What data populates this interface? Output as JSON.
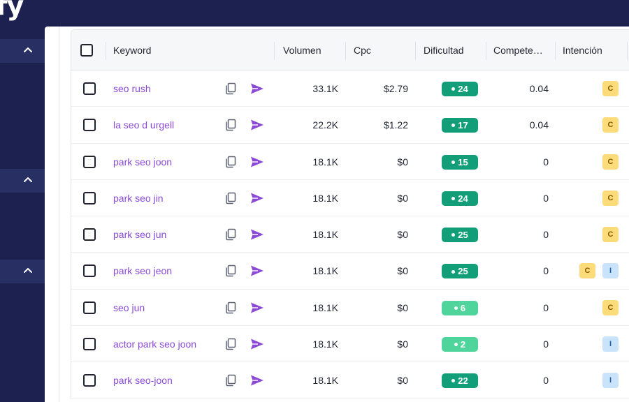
{
  "app": {
    "logo_text": "fy"
  },
  "colors": {
    "sidebar_bg": "#1c2150",
    "keyword_link": "#8a4ad6",
    "diff_dark": "#129e79",
    "diff_light": "#4fd49c"
  },
  "table": {
    "headers": {
      "select_all": "",
      "keyword": "Keyword",
      "volume": "Volumen",
      "cpc": "Cpc",
      "difficulty": "Dificultad",
      "competition": "Compete…",
      "intent": "Intención"
    },
    "rows": [
      {
        "keyword": "seo rush",
        "volume": "33.1K",
        "cpc": "$2.79",
        "difficulty": "24",
        "difficulty_level": "dark",
        "competition": "0.04",
        "intents": [
          "C"
        ]
      },
      {
        "keyword": "la seo d urgell",
        "volume": "22.2K",
        "cpc": "$1.22",
        "difficulty": "17",
        "difficulty_level": "dark",
        "competition": "0.04",
        "intents": [
          "C"
        ]
      },
      {
        "keyword": "park seo joon",
        "volume": "18.1K",
        "cpc": "$0",
        "difficulty": "15",
        "difficulty_level": "dark",
        "competition": "0",
        "intents": [
          "C"
        ]
      },
      {
        "keyword": "park seo jin",
        "volume": "18.1K",
        "cpc": "$0",
        "difficulty": "24",
        "difficulty_level": "dark",
        "competition": "0",
        "intents": [
          "C"
        ]
      },
      {
        "keyword": "park seo jun",
        "volume": "18.1K",
        "cpc": "$0",
        "difficulty": "25",
        "difficulty_level": "dark",
        "competition": "0",
        "intents": [
          "C"
        ]
      },
      {
        "keyword": "park seo jeon",
        "volume": "18.1K",
        "cpc": "$0",
        "difficulty": "25",
        "difficulty_level": "dark",
        "competition": "0",
        "intents": [
          "C",
          "I"
        ]
      },
      {
        "keyword": "seo jun",
        "volume": "18.1K",
        "cpc": "$0",
        "difficulty": "6",
        "difficulty_level": "light",
        "competition": "0",
        "intents": [
          "C"
        ]
      },
      {
        "keyword": "actor park seo joon",
        "volume": "18.1K",
        "cpc": "$0",
        "difficulty": "2",
        "difficulty_level": "light",
        "competition": "0",
        "intents": [
          "I"
        ]
      },
      {
        "keyword": "park seo-joon",
        "volume": "18.1K",
        "cpc": "$0",
        "difficulty": "22",
        "difficulty_level": "dark",
        "competition": "0",
        "intents": [
          "I"
        ]
      }
    ],
    "icons": {
      "copy": "copy-icon",
      "send": "send-icon",
      "expand": "chevron-up-icon"
    }
  }
}
